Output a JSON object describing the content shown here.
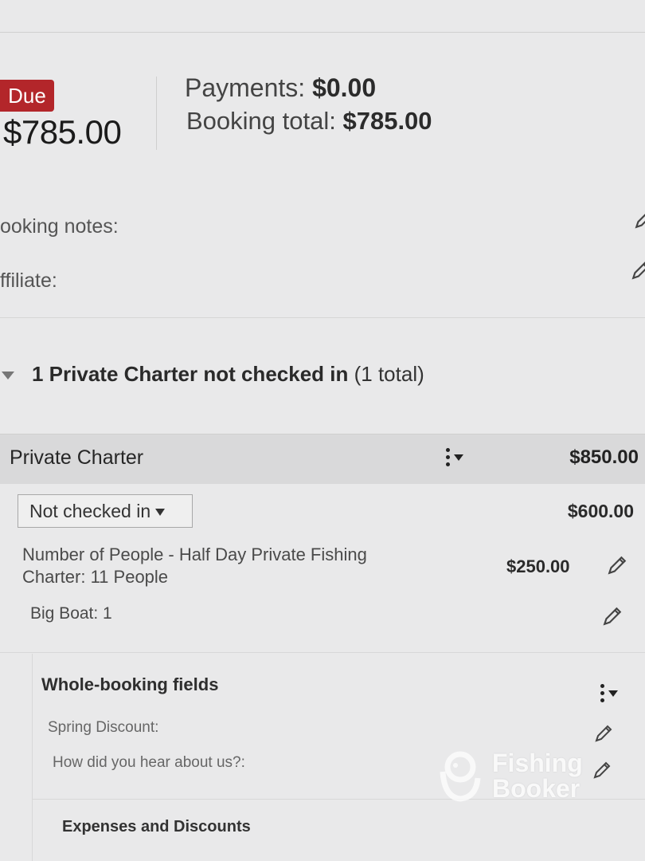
{
  "summary": {
    "due_label": "Due",
    "due_amount": "$785.00",
    "payments_label": "Payments:",
    "payments_value": "$0.00",
    "booking_total_label": "Booking total:",
    "booking_total_value": "$785.00"
  },
  "meta": {
    "booking_notes_label": "ooking notes:",
    "affiliate_label": "ffiliate:"
  },
  "section": {
    "title_bold": "1 Private Charter not checked in",
    "title_count": "(1 total)"
  },
  "charter": {
    "name": "Private Charter",
    "price": "$850.00",
    "status_value": "Not checked in",
    "status_price": "$600.00",
    "items": [
      {
        "label_line1": "Number of People - Half Day Private Fishing",
        "label_line2": "Charter: 11 People",
        "price": "$250.00"
      },
      {
        "label": "Big Boat: 1"
      }
    ]
  },
  "whole_booking": {
    "title": "Whole-booking fields",
    "fields": [
      {
        "label": "Spring Discount:"
      },
      {
        "label": "How did you hear about us?:"
      }
    ]
  },
  "expenses": {
    "title": "Expenses and Discounts"
  },
  "watermark": {
    "line1": "Fishing",
    "line2": "Booker"
  },
  "icons": {
    "edit": "pencil-icon",
    "menu": "kebab-menu-icon",
    "collapse": "caret-down-icon"
  },
  "colors": {
    "due_badge": "#b3262a",
    "background": "#e9e9ea",
    "charter_bar": "#d9d9da"
  }
}
